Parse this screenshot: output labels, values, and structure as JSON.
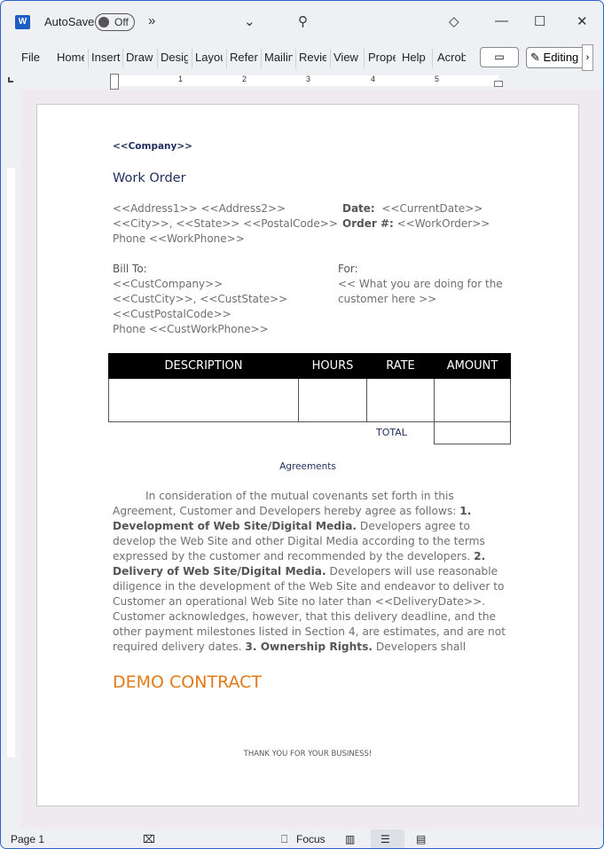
{
  "titlebar": {
    "app_icon": "word-icon",
    "autosave_label": "AutoSave",
    "autosave_state": "Off",
    "overflow": "»",
    "icons": [
      "chevron-down-icon",
      "search-icon",
      "diamond-icon",
      "minimize-icon",
      "maximize-icon",
      "close-icon"
    ]
  },
  "ribbon": {
    "tabs": [
      "File",
      "Home",
      "Insert",
      "Draw",
      "Design",
      "Layout",
      "References",
      "Mailings",
      "Review",
      "View",
      "Properties",
      "Help",
      "Acrobat"
    ],
    "comment_icon": "comment-icon",
    "editing_label": "Editing",
    "more": "›"
  },
  "ruler": {
    "numbers": [
      "1",
      "2",
      "3",
      "4",
      "5"
    ]
  },
  "document": {
    "company": "<<Company>>",
    "title": "Work Order",
    "address": [
      "<<Address1>> <<Address2>>",
      "<<City>>, <<State>> <<PostalCode>>",
      "Phone <<WorkPhone>>"
    ],
    "date_label": "Date:",
    "date_value": "<<CurrentDate>>",
    "order_label": "Order #:",
    "order_value": "<<WorkOrder>>",
    "bill_to_label": "Bill To:",
    "bill_to": [
      "<<CustCompany>>",
      "<<CustCity>>, <<CustState>>",
      "<<CustPostalCode>>",
      "Phone <<CustWorkPhone>>"
    ],
    "for_label": "For:",
    "for_lines": [
      "<< What you are doing for the",
      "customer here >>"
    ],
    "table": {
      "headers": [
        "DESCRIPTION",
        "HOURS",
        "RATE",
        "AMOUNT"
      ],
      "total_label": "TOTAL"
    },
    "agreements_title": "Agreements",
    "agreement": [
      {
        "t": "In consideration of the mutual covenants set forth in this Agreement, Customer and Developers hereby agree as follows: "
      },
      {
        "t": "1.  Development of Web Site/Digital Media.",
        "b": true
      },
      {
        "t": "  Developers agree to develop the Web Site and other Digital Media according to the terms expressed by the customer and recommended by the developers. "
      },
      {
        "t": "2.  Delivery of Web Site/Digital Media.",
        "b": true
      },
      {
        "t": "  Developers will use reasonable diligence in the development of the Web Site and endeavor to deliver to Customer an operational Web Site no later than <<DeliveryDate>>.  Customer acknowledges, however, that this delivery deadline, and the other payment milestones listed in Section 4, are estimates, and are not required delivery dates. "
      },
      {
        "t": "3.  Ownership Rights.",
        "b": true
      },
      {
        "t": "  Developers shall"
      }
    ],
    "watermark": "DEMO CONTRACT",
    "footer": "THANK YOU FOR YOUR BUSINESS!"
  },
  "status": {
    "page": "Page 1",
    "focus": "Focus",
    "icons": [
      "proofing-icon",
      "focus-icon",
      "read-mode-icon",
      "print-layout-icon",
      "web-layout-icon"
    ]
  },
  "colors": {
    "accent": "#e37a18",
    "navy": "#1e2e5e",
    "word_blue": "#1b5ec4"
  }
}
